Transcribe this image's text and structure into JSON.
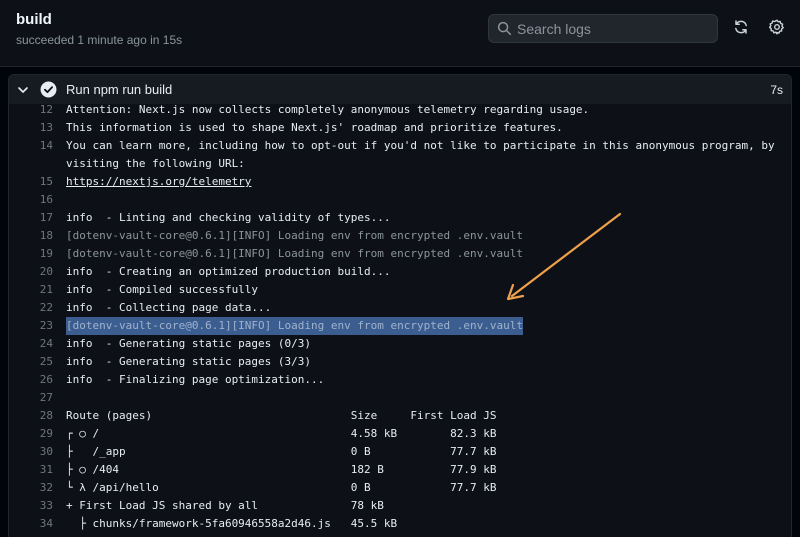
{
  "header": {
    "title": "build",
    "subtitle": "succeeded 1 minute ago in 15s",
    "search_placeholder": "Search logs"
  },
  "icons": {
    "refresh": "refresh-icon",
    "settings": "gear-icon",
    "search": "search-icon",
    "step_status": "check-circle-icon",
    "collapse": "chevron-down-icon"
  },
  "colors": {
    "success": "#8b949e",
    "highlight": "#3b5d90",
    "arrow": "#f0a04b",
    "link": "#e6edf3"
  },
  "step": {
    "name": "Run npm run build",
    "duration": "7s"
  },
  "log": [
    {
      "n": "12",
      "t": "Attention: Next.js now collects completely anonymous telemetry regarding usage."
    },
    {
      "n": "13",
      "t": "This information is used to shape Next.js' roadmap and prioritize features."
    },
    {
      "n": "14",
      "t": "You can learn more, including how to opt-out if you'd not like to participate in this anonymous program, by visiting the following URL:"
    },
    {
      "n": "15",
      "t": "https://nextjs.org/telemetry"
    },
    {
      "n": "16",
      "t": ""
    },
    {
      "n": "17",
      "t": "info  - Linting and checking validity of types..."
    },
    {
      "n": "18",
      "t": "[dotenv-vault-core@0.6.1][INFO] Loading env from encrypted .env.vault"
    },
    {
      "n": "19",
      "t": "[dotenv-vault-core@0.6.1][INFO] Loading env from encrypted .env.vault"
    },
    {
      "n": "20",
      "t": "info  - Creating an optimized production build..."
    },
    {
      "n": "21",
      "t": "info  - Compiled successfully"
    },
    {
      "n": "22",
      "t": "info  - Collecting page data..."
    },
    {
      "n": "23",
      "t": "[dotenv-vault-core@0.6.1][INFO] Loading env from encrypted .env.vault"
    },
    {
      "n": "24",
      "t": "info  - Generating static pages (0/3)"
    },
    {
      "n": "25",
      "t": "info  - Generating static pages (3/3)"
    },
    {
      "n": "26",
      "t": "info  - Finalizing page optimization..."
    },
    {
      "n": "27",
      "t": ""
    },
    {
      "n": "28",
      "t": "Route (pages)                              Size     First Load JS"
    },
    {
      "n": "29",
      "t": "┌ ○ /                                      4.58 kB        82.3 kB"
    },
    {
      "n": "30",
      "t": "├   /_app                                  0 B            77.7 kB"
    },
    {
      "n": "31",
      "t": "├ ○ /404                                   182 B          77.9 kB"
    },
    {
      "n": "32",
      "t": "└ λ /api/hello                             0 B            77.7 kB"
    },
    {
      "n": "33",
      "t": "+ First Load JS shared by all              78 kB"
    },
    {
      "n": "34",
      "t": "  ├ chunks/framework-5fa60946558a2d46.js   45.5 kB"
    }
  ]
}
